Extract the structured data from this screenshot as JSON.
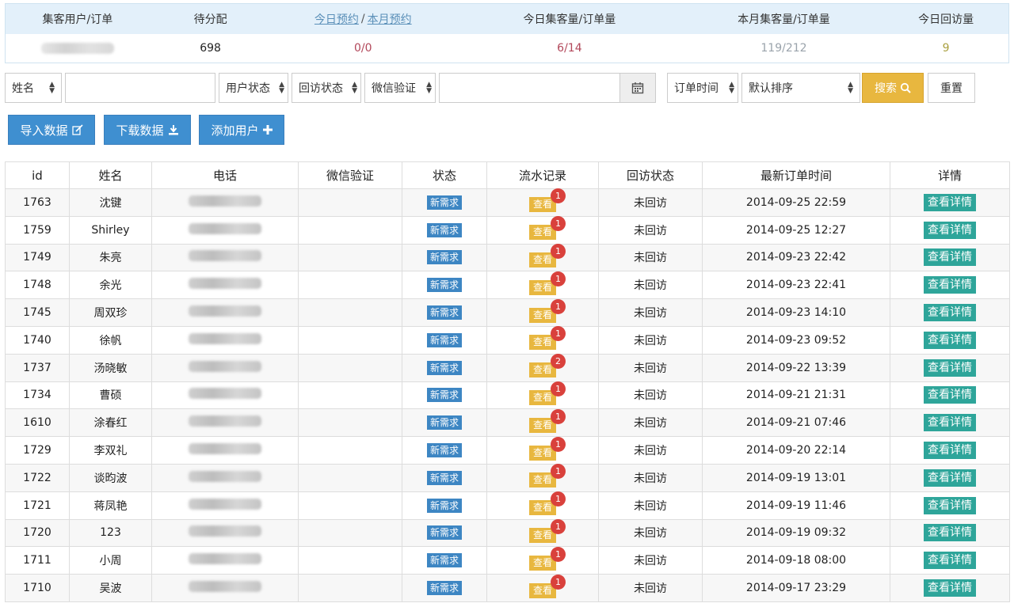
{
  "stats": {
    "headers": {
      "col1": "集客用户/订单",
      "col2": "待分配",
      "col3_link_today": "今日预约",
      "col3_sep": "/",
      "col3_link_month": "本月预约",
      "col4": "今日集客量/订单量",
      "col5": "本月集客量/订单量",
      "col6": "今日回访量"
    },
    "values": {
      "col2": "698",
      "col3": "0/0",
      "col4": "6/14",
      "col5": "119/212",
      "col6": "9"
    }
  },
  "filter": {
    "name_select": "姓名",
    "user_status": "用户状态",
    "visit_status": "回访状态",
    "wechat_verify": "微信验证",
    "order_time": "订单时间",
    "sort": "默认排序",
    "search": "搜索",
    "reset": "重置"
  },
  "actions": {
    "import": "导入数据",
    "download": "下载数据",
    "add_user": "添加用户"
  },
  "table": {
    "headers": [
      "id",
      "姓名",
      "电话",
      "微信验证",
      "状态",
      "流水记录",
      "回访状态",
      "最新订单时间",
      "详情"
    ],
    "status_label": "新需求",
    "view_label": "查看",
    "detail_label": "查看详情",
    "visit_label": "未回访",
    "rows": [
      {
        "id": "1763",
        "name": "沈键",
        "count": "1",
        "time": "2014-09-25 22:59"
      },
      {
        "id": "1759",
        "name": "Shirley",
        "count": "1",
        "time": "2014-09-25 12:27"
      },
      {
        "id": "1749",
        "name": "朱亮",
        "count": "1",
        "time": "2014-09-23 22:42"
      },
      {
        "id": "1748",
        "name": "余光",
        "count": "1",
        "time": "2014-09-23 22:41"
      },
      {
        "id": "1745",
        "name": "周双珍",
        "count": "1",
        "time": "2014-09-23 14:10"
      },
      {
        "id": "1740",
        "name": "徐帆",
        "count": "1",
        "time": "2014-09-23 09:52"
      },
      {
        "id": "1737",
        "name": "汤晓敏",
        "count": "2",
        "time": "2014-09-22 13:39"
      },
      {
        "id": "1734",
        "name": "曹硕",
        "count": "1",
        "time": "2014-09-21 21:31"
      },
      {
        "id": "1610",
        "name": "涂春红",
        "count": "1",
        "time": "2014-09-21 07:46"
      },
      {
        "id": "1729",
        "name": "李双礼",
        "count": "1",
        "time": "2014-09-20 22:14"
      },
      {
        "id": "1722",
        "name": "谈昀波",
        "count": "1",
        "time": "2014-09-19 13:01"
      },
      {
        "id": "1721",
        "name": "蒋凤艳",
        "count": "1",
        "time": "2014-09-19 11:46"
      },
      {
        "id": "1720",
        "name": "123",
        "count": "1",
        "time": "2014-09-19 09:32"
      },
      {
        "id": "1711",
        "name": "小周",
        "count": "1",
        "time": "2014-09-18 08:00"
      },
      {
        "id": "1710",
        "name": "吴波",
        "count": "1",
        "time": "2014-09-17 23:29"
      }
    ]
  },
  "icons": {
    "calendar": "calendar-icon",
    "search": "search-icon",
    "edit": "edit-icon",
    "download": "download-icon",
    "plus": "plus-icon",
    "select_arrows": "sort-arrows-icon"
  },
  "colors": {
    "primary_blue": "#3f8fd0",
    "search_yellow": "#e8b73f",
    "detail_teal": "#2ea59a",
    "count_red": "#d9413c",
    "stats_header_bg": "#e3f0fa"
  }
}
